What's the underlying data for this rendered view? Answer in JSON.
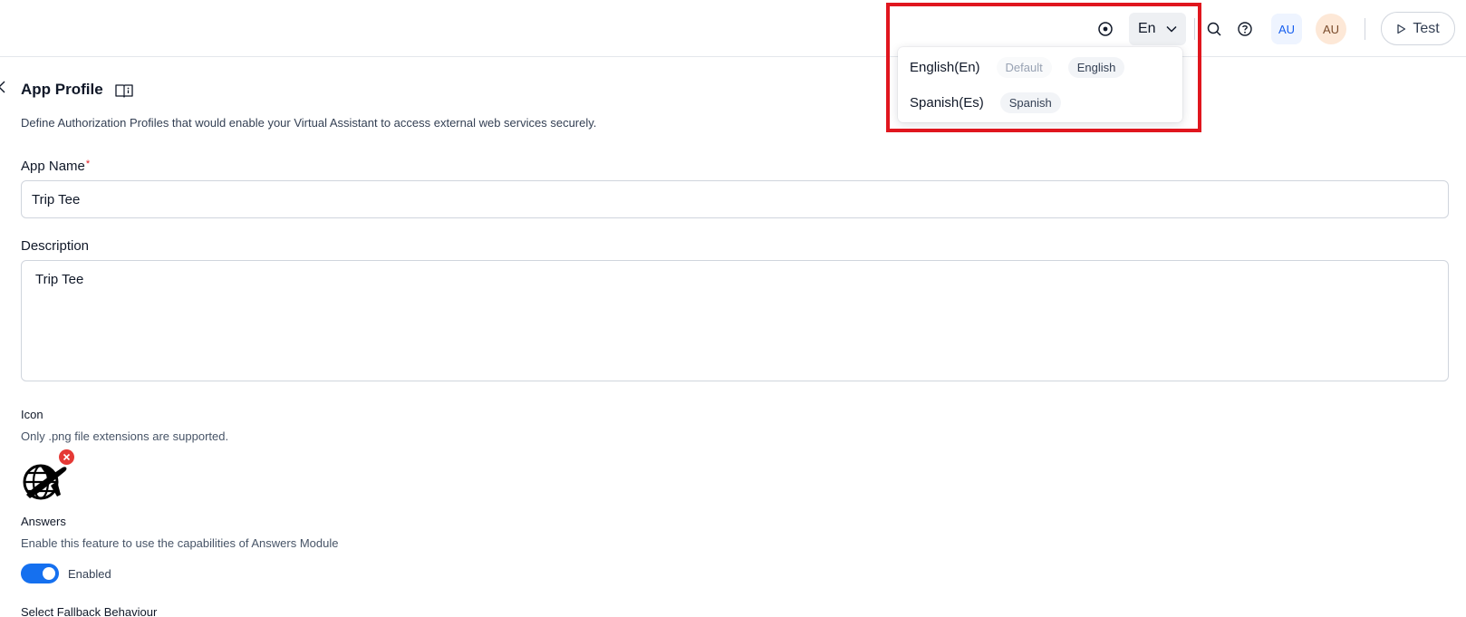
{
  "header": {
    "language_select": {
      "value": "En"
    },
    "avatars": [
      "AU",
      "AU"
    ],
    "test_button": "Test"
  },
  "language_dropdown": {
    "options": [
      {
        "name": "English(En)",
        "tags": [
          "Default",
          "English"
        ]
      },
      {
        "name": "Spanish(Es)",
        "tags": [
          "Spanish"
        ]
      }
    ]
  },
  "page": {
    "title": "App Profile",
    "description": "Define Authorization Profiles that would enable your Virtual Assistant to access external web services securely."
  },
  "form": {
    "app_name": {
      "label": "App Name",
      "required_mark": "*",
      "value": "Trip Tee"
    },
    "description": {
      "label": "Description",
      "value": "Trip Tee"
    },
    "icon": {
      "label": "Icon",
      "hint": "Only .png file extensions are supported.",
      "image": "globe-airplane-icon"
    },
    "answers": {
      "label": "Answers",
      "hint": "Enable this feature to use the capabilities of Answers Module",
      "enabled": true,
      "state_label": "Enabled"
    },
    "fallback": {
      "label": "Select Fallback Behaviour"
    }
  },
  "colors": {
    "accent": "#1570ef",
    "highlight": "#e0161e",
    "remove": "#e53935"
  }
}
